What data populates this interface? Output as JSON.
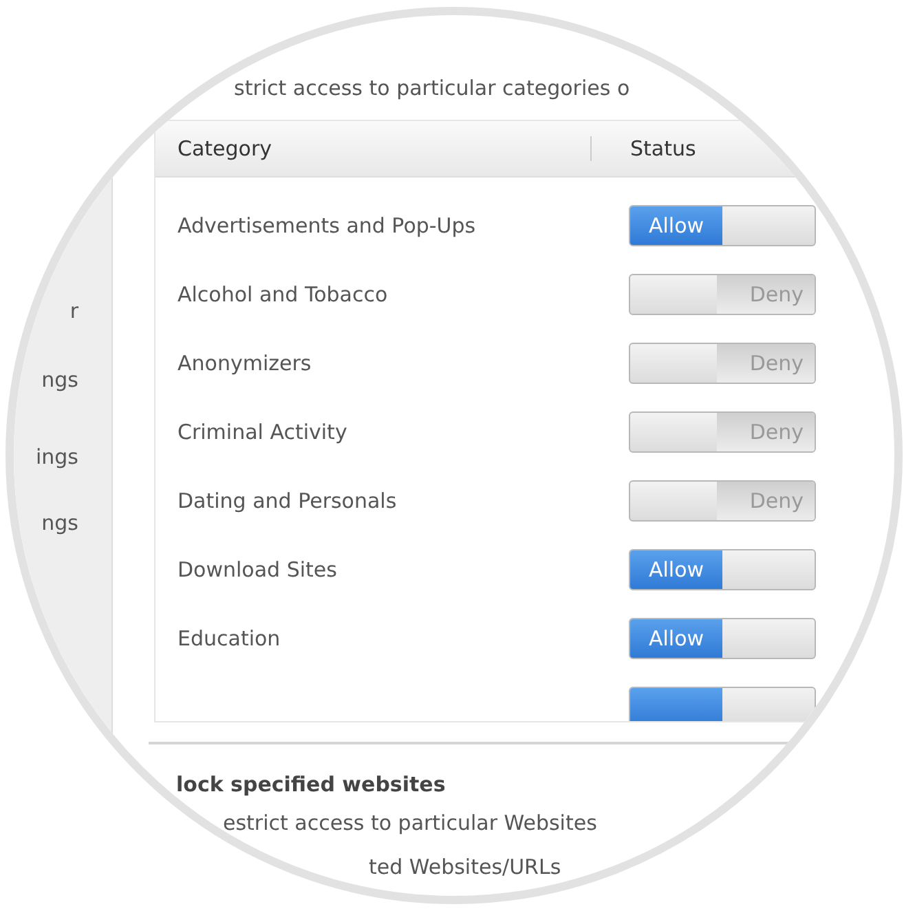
{
  "sidebar": {
    "items": [
      "r",
      "ngs",
      "ings",
      "ngs"
    ]
  },
  "categories_section": {
    "description": "strict access to particular categories o"
  },
  "table": {
    "columns": [
      "Category",
      "Status"
    ],
    "rows": [
      {
        "category": "Advertisements and Pop-Ups",
        "allowed": true,
        "status": "Allow"
      },
      {
        "category": "Alcohol and Tobacco",
        "allowed": false,
        "status": "Deny"
      },
      {
        "category": "Anonymizers",
        "allowed": false,
        "status": "Deny"
      },
      {
        "category": "Criminal Activity",
        "allowed": false,
        "status": "Deny"
      },
      {
        "category": "Dating and Personals",
        "allowed": false,
        "status": "Deny"
      },
      {
        "category": "Download Sites",
        "allowed": true,
        "status": "Allow"
      },
      {
        "category": "Education",
        "allowed": true,
        "status": "Allow"
      },
      {
        "allowed": true
      }
    ]
  },
  "websites_section": {
    "title": "lock specified websites",
    "description": "estrict access to particular Websites",
    "link": "ted Websites/URLs"
  }
}
